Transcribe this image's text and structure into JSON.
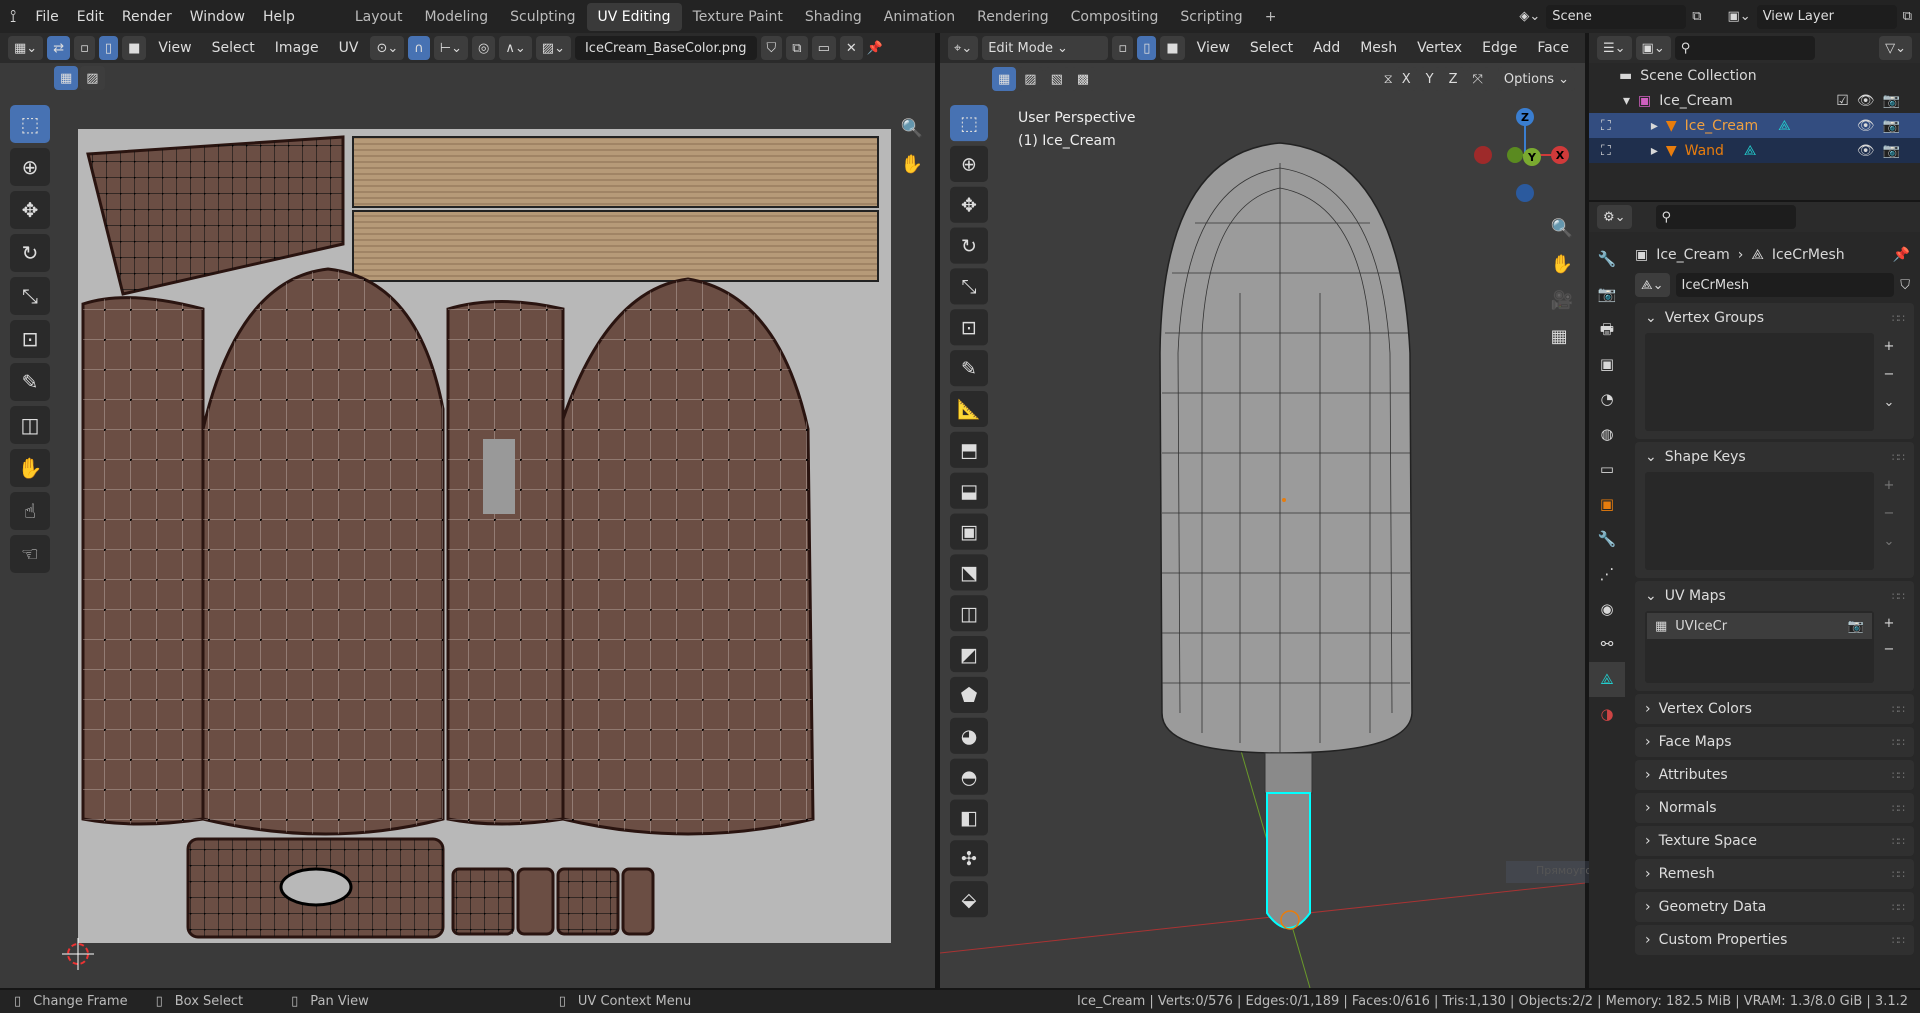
{
  "topbar": {
    "menus": [
      "File",
      "Edit",
      "Render",
      "Window",
      "Help"
    ],
    "workspaces": [
      "Layout",
      "Modeling",
      "Sculpting",
      "UV Editing",
      "Texture Paint",
      "Shading",
      "Animation",
      "Rendering",
      "Compositing",
      "Scripting"
    ],
    "active_workspace": "UV Editing",
    "scene": "Scene",
    "view_layer": "View Layer"
  },
  "uv_editor": {
    "menus": [
      "View",
      "Select",
      "Image",
      "UV"
    ],
    "image_name": "IceCream_BaseColor.png"
  },
  "viewport": {
    "mode": "Edit Mode",
    "menus": [
      "View",
      "Select",
      "Add",
      "Mesh",
      "Vertex",
      "Edge",
      "Face"
    ],
    "axes": [
      "X",
      "Y",
      "Z"
    ],
    "options": "Options",
    "perspective": "User Perspective",
    "object_label": "(1) Ice_Cream",
    "gizmo": {
      "z": "Z",
      "y": "Y",
      "x": "X"
    },
    "faint_popup": "Прямоугольник"
  },
  "outliner": {
    "scene_collection": "Scene Collection",
    "collection": "Ice_Cream",
    "items": [
      {
        "name": "Ice_Cream",
        "selected": true
      },
      {
        "name": "Wand",
        "selected": false
      }
    ]
  },
  "properties": {
    "breadcrumb_object": "Ice_Cream",
    "breadcrumb_mesh": "IceCrMesh",
    "mesh_name": "IceCrMesh",
    "panels": {
      "vertex_groups": "Vertex Groups",
      "shape_keys": "Shape Keys",
      "uv_maps": "UV Maps",
      "uv_map_item": "UVIceCr"
    },
    "collapsed": [
      "Vertex Colors",
      "Face Maps",
      "Attributes",
      "Normals",
      "Texture Space",
      "Remesh",
      "Geometry Data",
      "Custom Properties"
    ]
  },
  "status": {
    "change_frame": "Change Frame",
    "box_select": "Box Select",
    "pan_view": "Pan View",
    "context_menu": "UV Context Menu",
    "stats": "Ice_Cream | Verts:0/576 | Edges:0/1,189 | Faces:0/616 | Tris:1,130 | Objects:2/2 | Memory: 182.5 MiB | VRAM: 1.3/8.0 GiB | 3.1.2"
  },
  "colors": {
    "accent": "#4772b3",
    "uv_island": "#6b4e44",
    "selection_edge": "#00ffff",
    "orange": "#e87d0d"
  }
}
